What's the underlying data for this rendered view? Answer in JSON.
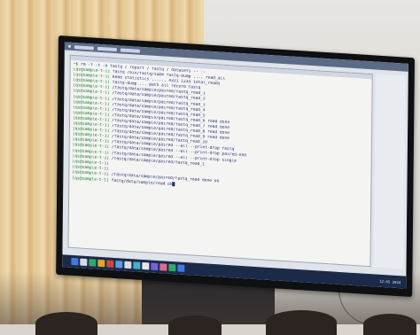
{
  "scene": {
    "description_free": true
  },
  "terminal": {
    "lines": [
      {
        "prompt": "",
        "text": "~$ rm -f -t -o fastq / report / fastq / datasets  -- --"
      },
      {
        "prompt": "[qs@sample-t-1]",
        "text": "fastq /bin/fastq/summ  fastq-dump .... read_all"
      },
      {
        "prompt": "[qs@sample-t-1]",
        "text": "Read statistics ...... 4321  1234  total_reads"
      },
      {
        "prompt": "[qs@sample-t-1]",
        "text": "fastq-dump ... path  all   record  fastq"
      },
      {
        "prompt": "[qs@sample-t-1]",
        "text": "/fastq/data/sample/paired/fastq_read_1"
      },
      {
        "prompt": "[qs@sample-t-1]",
        "text": "/fastq/data/sample/paired/fastq_read_2"
      },
      {
        "prompt": "[qs@sample-t-1]",
        "text": "/fastq/data/sample/paired/fastq_read_3"
      },
      {
        "prompt": "[qs@sample-t-1]",
        "text": "/fastq/data/sample/paired/fastq_read_4"
      },
      {
        "prompt": "[qs@sample-t-1]",
        "text": "/fastq/data/sample/paired/fastq_read_5"
      },
      {
        "prompt": "[qs@sample-t-1]",
        "text": "/fastq/data/sample/paired/fastq_read_6  read  done"
      },
      {
        "prompt": "[qs@sample-t-1]",
        "text": "/fastq/data/sample/paired/fastq_read_7  read  done"
      },
      {
        "prompt": "[qs@sample-t-1]",
        "text": "/fastq/data/sample/paired/fastq_read_8  read  done"
      },
      {
        "prompt": "[qs@sample-t-1]",
        "text": "/fastq/data/sample/paired/fastq_read_9  read  done"
      },
      {
        "prompt": "[qs@sample-t-1]",
        "text": "/fastq/data/sample/paired/fastq_read_10"
      },
      {
        "prompt": "[qs@sample-t-1]",
        "text": "/fastq/data/sample/paired  --all  --print-drop  fastq"
      },
      {
        "prompt": "[qs@sample-t-1]",
        "text": "/fastq/data/sample/paired  --all  --print-drop  paired-end"
      },
      {
        "prompt": "[qs@sample-t-1]",
        "text": "/fastq/data/sample/paired  --all  --print-drop  single"
      },
      {
        "prompt": "[qs@sample-t-1]",
        "text": "/fastq/data/sample/paired/fastq_read_1"
      },
      {
        "prompt": "[qs@sample-t-1]",
        "text": ""
      },
      {
        "prompt": "[qs@sample-t-1]",
        "text": ""
      },
      {
        "prompt": "[qs@sample-t-1]",
        "text": "/fastq/data/sample/paired/fastq_read  done  ok"
      },
      {
        "prompt": "[qs@sample-t-1]",
        "text": "fastq/data/sample/read  ok"
      }
    ]
  },
  "taskbar": {
    "tray_text": "12:45  2024"
  },
  "colors": {
    "terminal_bg": "#f4f4f2",
    "prompt": "#1a7a2c",
    "command": "#26337a",
    "taskbar": "#1c2a4a",
    "topbar": "#5b6b86"
  }
}
